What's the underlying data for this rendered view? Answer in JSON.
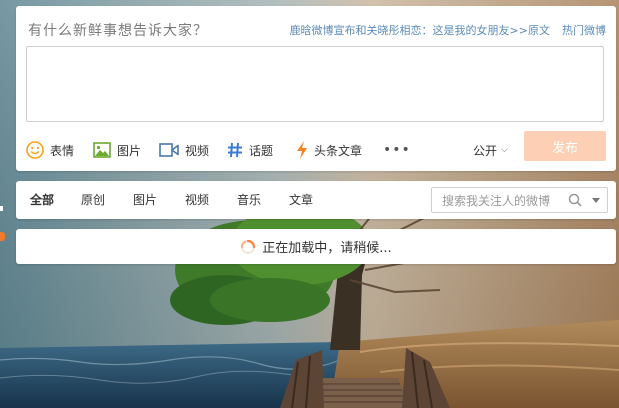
{
  "composer": {
    "prompt": "有什么新鲜事想告诉大家？",
    "hot_topic": "鹿晗微博宣布和关晓彤相恋：这是我的女朋友>>原文",
    "hot_weibo": "热门微博",
    "text": "",
    "tools": [
      {
        "label": "表情",
        "icon": "emoji-icon"
      },
      {
        "label": "图片",
        "icon": "image-icon"
      },
      {
        "label": "视频",
        "icon": "video-icon"
      },
      {
        "label": "话题",
        "icon": "hashtag-icon"
      },
      {
        "label": "头条文章",
        "icon": "lightning-icon"
      }
    ],
    "more": "•••",
    "visibility": "公开",
    "publish_label": "发布"
  },
  "filter": {
    "tabs": [
      "全部",
      "原创",
      "图片",
      "视频",
      "音乐",
      "文章"
    ],
    "active_tab": "全部",
    "search_placeholder": "搜索我关注人的微博"
  },
  "feed": {
    "loading_text": "正在加载中，请稍候..."
  },
  "colors": {
    "accent_orange": "#ff8140",
    "publish_disabled": "#fdcfb4",
    "link_blue": "#5b8bb7"
  }
}
